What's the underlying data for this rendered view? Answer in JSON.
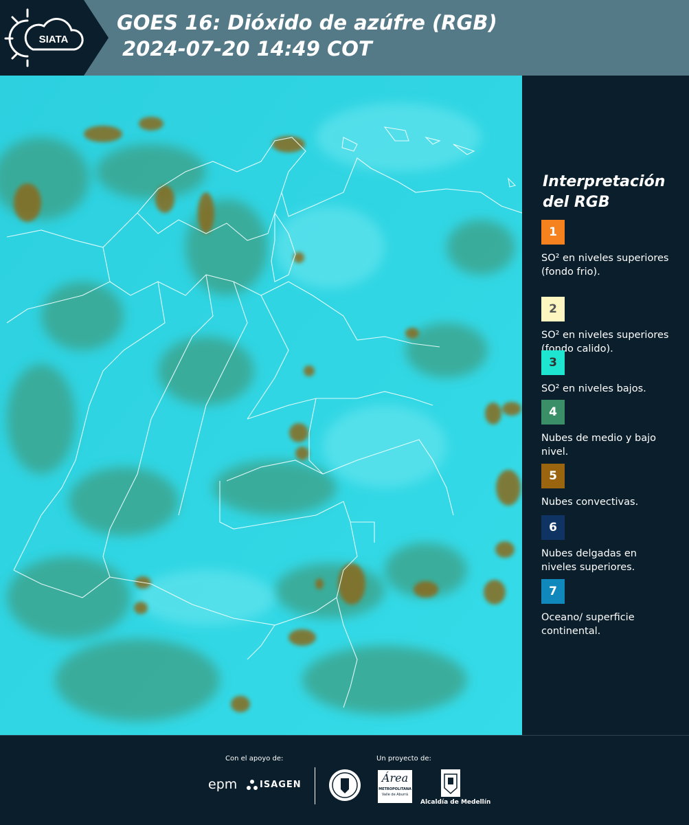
{
  "header": {
    "logo_text": "SIATA",
    "title_line1": "GOES 16: Dióxido de azúfre (RGB)",
    "title_line2": "2024-07-20 14:49 COT"
  },
  "legend": {
    "title_line1": "Interpretación",
    "title_line2": "del RGB",
    "items": [
      {
        "num": "1",
        "color": "#f5821f",
        "text_color": "#ffffff",
        "desc": "SO² en niveles superiores (fondo frio)."
      },
      {
        "num": "2",
        "color": "#fdf6c0",
        "text_color": "#555555",
        "desc": "SO² en niveles superiores (fondo calido)."
      },
      {
        "num": "3",
        "color": "#1ee5cf",
        "text_color": "#333333",
        "desc": "SO² en niveles bajos."
      },
      {
        "num": "4",
        "color": "#3a8f68",
        "text_color": "#ffffff",
        "desc": "Nubes de medio y bajo nivel."
      },
      {
        "num": "5",
        "color": "#9b650f",
        "text_color": "#ffffff",
        "desc": "Nubes convectivas."
      },
      {
        "num": "6",
        "color": "#0f3463",
        "text_color": "#ffffff",
        "desc": "Nubes delgadas en niveles superiores."
      },
      {
        "num": "7",
        "color": "#1088bb",
        "text_color": "#ffffff",
        "desc": "Oceano/ superficie continental."
      }
    ]
  },
  "footer": {
    "support_label": "Con el apoyo de:",
    "project_label": "Un proyecto de:",
    "sponsor_epm": "epm",
    "sponsor_isagen": "ISAGEN",
    "partner_area": "Área",
    "partner_area_sub": "METROPOLITANA",
    "partner_area_sub2": "Valle de Aburrá",
    "partner_alcaldia": "Alcaldía de Medellín"
  },
  "colors": {
    "header_bg": "#557a87",
    "panel_bg": "#0b1e2c",
    "sea": "#2fd6e6",
    "clouds_low": "#3d9e8a",
    "convective": "#8a6a1f"
  }
}
